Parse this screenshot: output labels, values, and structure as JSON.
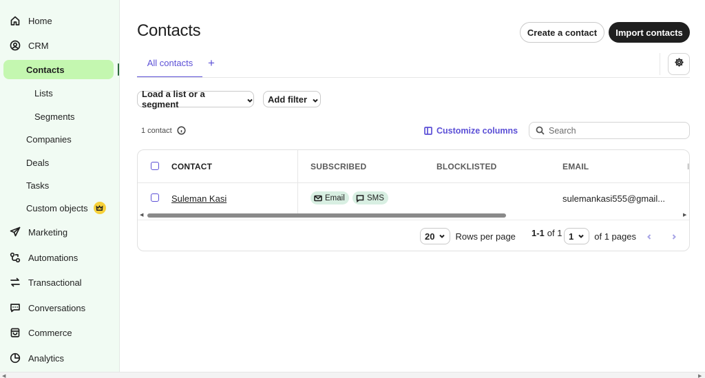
{
  "sidebar": {
    "items": [
      {
        "label": "Home",
        "icon": "home-icon"
      },
      {
        "label": "CRM",
        "icon": "user-circle-icon"
      },
      {
        "label": "Contacts"
      },
      {
        "label": "Lists"
      },
      {
        "label": "Segments"
      },
      {
        "label": "Companies"
      },
      {
        "label": "Deals"
      },
      {
        "label": "Tasks"
      },
      {
        "label": "Custom objects",
        "badge_icon": "crown-icon"
      },
      {
        "label": "Marketing",
        "icon": "paper-plane-icon"
      },
      {
        "label": "Automations",
        "icon": "automation-icon"
      },
      {
        "label": "Transactional",
        "icon": "arrows-swap-icon"
      },
      {
        "label": "Conversations",
        "icon": "chat-icon"
      },
      {
        "label": "Commerce",
        "icon": "bag-icon"
      },
      {
        "label": "Analytics",
        "icon": "pie-chart-icon"
      }
    ],
    "active_item": "Contacts",
    "active_color": "#c4f7b0",
    "background": "#f1fbf3"
  },
  "header": {
    "title": "Contacts",
    "create_label": "Create a contact",
    "import_label": "Import contacts"
  },
  "tabs": {
    "active_label": "All contacts",
    "add_label": "+",
    "accent": "#5b4fd6"
  },
  "filters": {
    "load_label": "Load a list or a segment",
    "add_filter_label": "Add filter"
  },
  "toolbar": {
    "count_label": "1 contact",
    "customize_label": "Customize columns",
    "search_placeholder": "Search"
  },
  "table": {
    "columns": [
      "CONTACT",
      "SUBSCRIBED",
      "BLOCKLISTED",
      "EMAIL"
    ],
    "rows": [
      {
        "contact": "Suleman Kasi",
        "subscribed": [
          "Email",
          "SMS"
        ],
        "blocklisted": "",
        "email": "sulemankasi555@gmail..."
      }
    ]
  },
  "pagination": {
    "rows_per_page_value": "20",
    "rows_per_page_label": "Rows per page",
    "range_bold": "1-1",
    "range_rest": "of 1",
    "page_value": "1",
    "pages_label": "of 1 pages"
  }
}
